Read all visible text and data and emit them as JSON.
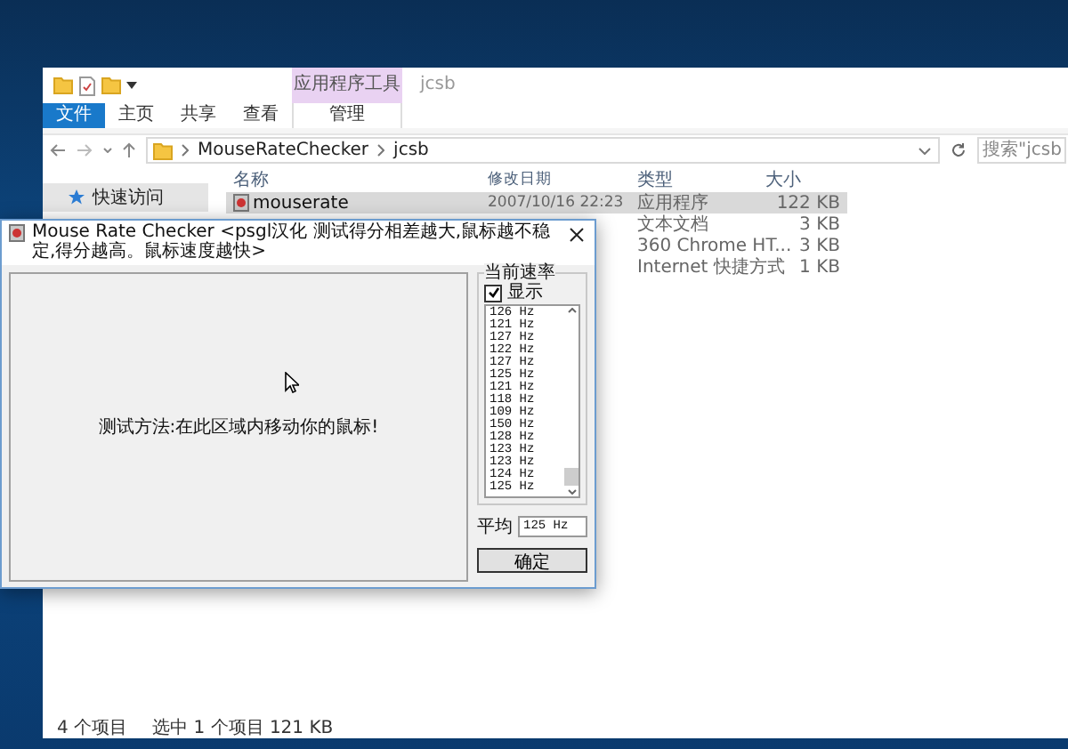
{
  "explorer": {
    "title": "jcsb",
    "context_tab": "应用程序工具",
    "ribbon_tabs": [
      {
        "label": "文件",
        "kind": "file"
      },
      {
        "label": "主页",
        "kind": "tab"
      },
      {
        "label": "共享",
        "kind": "tab"
      },
      {
        "label": "查看",
        "kind": "tab"
      },
      {
        "label": "管理",
        "kind": "context"
      }
    ],
    "path": [
      "MouseRateChecker",
      "jcsb"
    ],
    "search": {
      "placeholder": "搜索\"jcsb"
    },
    "sidebar": {
      "items": [
        {
          "label": "快速访问"
        }
      ]
    },
    "columns": [
      "名称",
      "修改日期",
      "类型",
      "大小"
    ],
    "rows": [
      {
        "name": "mouserate",
        "modified": "2007/10/16 22:23",
        "type": "应用程序",
        "size": "122 KB",
        "selected": true
      },
      {
        "type": "文本文档",
        "size": "3 KB",
        "selected": false
      },
      {
        "type": "360 Chrome HT...",
        "size": "3 KB",
        "selected": false
      },
      {
        "type": "Internet 快捷方式",
        "size": "1 KB",
        "selected": false
      }
    ],
    "status_bar": [
      "4 个项目",
      "选中 1 个项目  121 KB"
    ]
  },
  "dialog": {
    "title": "Mouse Rate Checker <psgl汉化  测试得分相差越大,鼠标越不稳定,得分越高。鼠标速度越快>",
    "canvas_hint": "测试方法:在此区域内移动你的鼠标!",
    "group_title": "当前速率",
    "show_checkbox": {
      "label": "显示",
      "checked": true
    },
    "rates": [
      "126 Hz",
      "121 Hz",
      "127 Hz",
      "122 Hz",
      "127 Hz",
      "125 Hz",
      "121 Hz",
      "118 Hz",
      "109 Hz",
      "150 Hz",
      "128 Hz",
      "123 Hz",
      "123 Hz",
      "124 Hz",
      "125 Hz"
    ],
    "average_label": "平均",
    "average_value": "125 Hz",
    "ok_button": "确定"
  }
}
